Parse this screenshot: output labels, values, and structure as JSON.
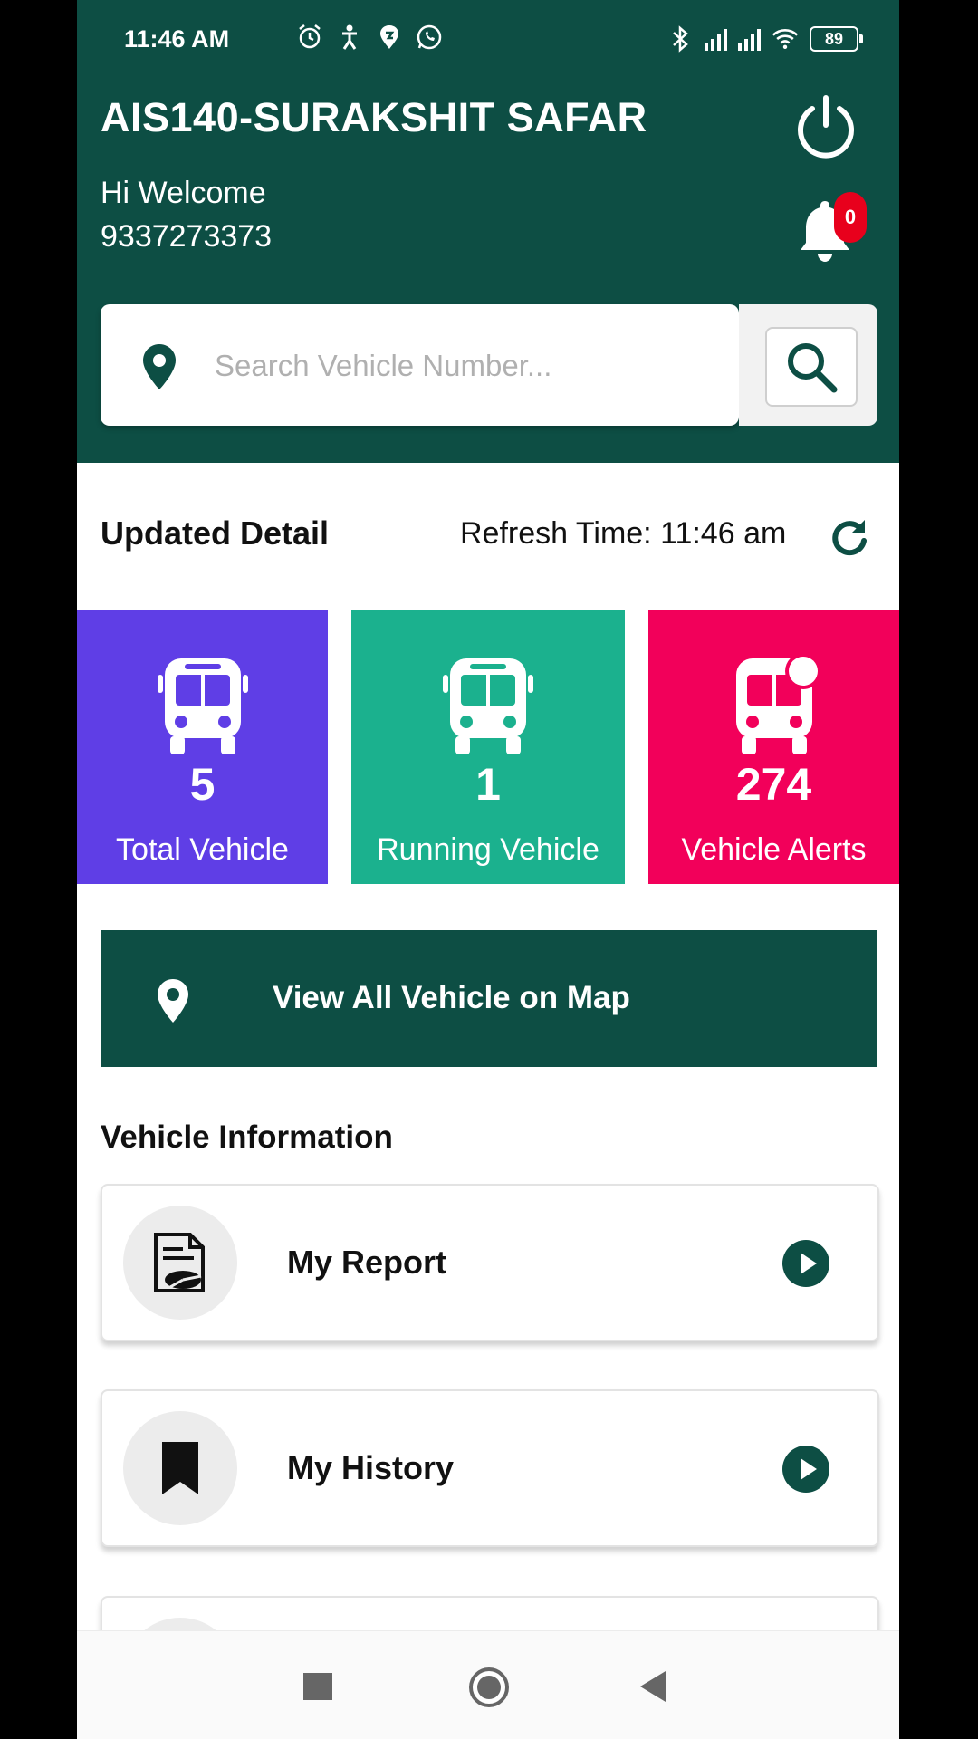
{
  "status_bar": {
    "time": "11:46 AM",
    "battery": "89",
    "left_icons": [
      "alarm-icon",
      "accessibility-icon",
      "swiggy-icon",
      "whatsapp-icon"
    ],
    "right_icons": [
      "bluetooth-icon",
      "signal-icon",
      "signal-icon",
      "wifi-icon",
      "battery-icon"
    ]
  },
  "header": {
    "title": "AIS140-SURAKSHIT SAFAR",
    "welcome": "Hi Welcome",
    "phone": "9337273373",
    "notification_count": "0",
    "bg_color": "#0d4e44"
  },
  "search": {
    "placeholder": "Search Vehicle Number..."
  },
  "updated": {
    "title": "Updated Detail",
    "refresh_label": "Refresh Time: 11:46 am"
  },
  "stats": [
    {
      "label": "Total Vehicle",
      "value": "5",
      "color": "#5f3ee6"
    },
    {
      "label": "Running Vehicle",
      "value": "1",
      "color": "#1bb18e"
    },
    {
      "label": "Vehicle Alerts",
      "value": "274",
      "color": "#f2005a"
    }
  ],
  "map_button": {
    "label": "View All Vehicle on Map"
  },
  "vehicle_info": {
    "title": "Vehicle Information",
    "items": [
      {
        "label": "My Report",
        "icon": "report-icon"
      },
      {
        "label": "My History",
        "icon": "bookmark-icon"
      }
    ]
  }
}
